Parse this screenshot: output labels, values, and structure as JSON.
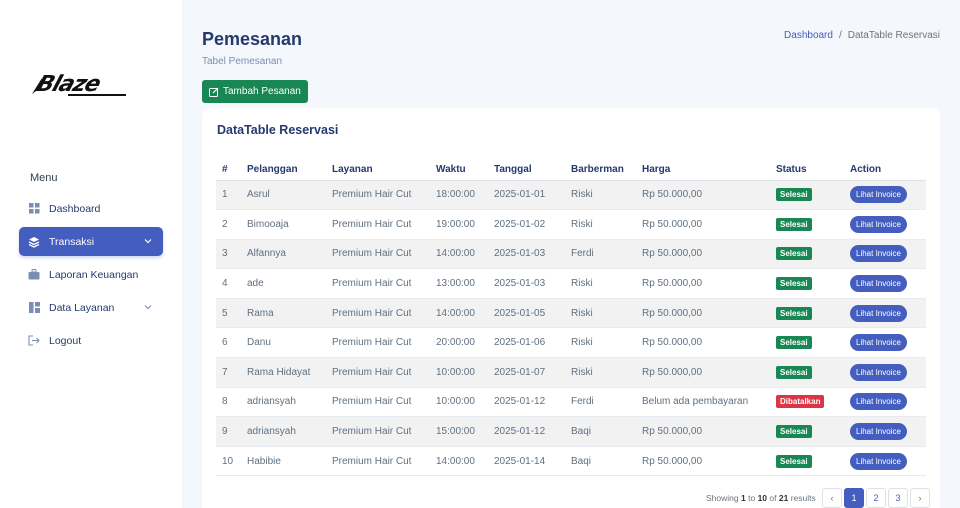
{
  "sidebar": {
    "logo_text": "Blaze",
    "menu_title": "Menu",
    "items": [
      {
        "label": "Dashboard",
        "icon": "grid-icon",
        "has_submenu": false,
        "active": false
      },
      {
        "label": "Transaksi",
        "icon": "stack-icon",
        "has_submenu": true,
        "active": true
      },
      {
        "label": "Laporan Keuangan",
        "icon": "briefcase-icon",
        "has_submenu": false,
        "active": false
      },
      {
        "label": "Data Layanan",
        "icon": "layout-icon",
        "has_submenu": true,
        "active": false
      },
      {
        "label": "Logout",
        "icon": "logout-icon",
        "has_submenu": false,
        "active": false
      }
    ]
  },
  "header": {
    "title": "Pemesanan",
    "subtitle": "Tabel Pemesanan",
    "breadcrumb": {
      "home": "Dashboard",
      "separator": "/",
      "current": "DataTable Reservasi"
    }
  },
  "actions": {
    "add_label": "Tambah Pesanan"
  },
  "card": {
    "title": "DataTable Reservasi"
  },
  "table": {
    "columns": [
      "#",
      "Pelanggan",
      "Layanan",
      "Waktu",
      "Tanggal",
      "Barberman",
      "Harga",
      "Status",
      "Action"
    ],
    "rows": [
      {
        "no": "1",
        "pelanggan": "Asrul",
        "layanan": "Premium Hair Cut",
        "waktu": "18:00:00",
        "tanggal": "2025-01-01",
        "barberman": "Riski",
        "harga": "Rp 50.000,00",
        "status": "Selesai",
        "action": "Lihat Invoice"
      },
      {
        "no": "2",
        "pelanggan": "Bimooaja",
        "layanan": "Premium Hair Cut",
        "waktu": "19:00:00",
        "tanggal": "2025-01-02",
        "barberman": "Riski",
        "harga": "Rp 50.000,00",
        "status": "Selesai",
        "action": "Lihat Invoice"
      },
      {
        "no": "3",
        "pelanggan": "Alfannya",
        "layanan": "Premium Hair Cut",
        "waktu": "14:00:00",
        "tanggal": "2025-01-03",
        "barberman": "Ferdi",
        "harga": "Rp 50.000,00",
        "status": "Selesai",
        "action": "Lihat Invoice"
      },
      {
        "no": "4",
        "pelanggan": "ade",
        "layanan": "Premium Hair Cut",
        "waktu": "13:00:00",
        "tanggal": "2025-01-03",
        "barberman": "Riski",
        "harga": "Rp 50.000,00",
        "status": "Selesai",
        "action": "Lihat Invoice"
      },
      {
        "no": "5",
        "pelanggan": "Rama",
        "layanan": "Premium Hair Cut",
        "waktu": "14:00:00",
        "tanggal": "2025-01-05",
        "barberman": "Riski",
        "harga": "Rp 50.000,00",
        "status": "Selesai",
        "action": "Lihat Invoice"
      },
      {
        "no": "6",
        "pelanggan": "Danu",
        "layanan": "Premium Hair Cut",
        "waktu": "20:00:00",
        "tanggal": "2025-01-06",
        "barberman": "Riski",
        "harga": "Rp 50.000,00",
        "status": "Selesai",
        "action": "Lihat Invoice"
      },
      {
        "no": "7",
        "pelanggan": "Rama Hidayat",
        "layanan": "Premium Hair Cut",
        "waktu": "10:00:00",
        "tanggal": "2025-01-07",
        "barberman": "Riski",
        "harga": "Rp 50.000,00",
        "status": "Selesai",
        "action": "Lihat Invoice"
      },
      {
        "no": "8",
        "pelanggan": "adriansyah",
        "layanan": "Premium Hair Cut",
        "waktu": "10:00:00",
        "tanggal": "2025-01-12",
        "barberman": "Ferdi",
        "harga": "Belum ada pembayaran",
        "status": "Dibatalkan",
        "action": "Lihat Invoice"
      },
      {
        "no": "9",
        "pelanggan": "adriansyah",
        "layanan": "Premium Hair Cut",
        "waktu": "15:00:00",
        "tanggal": "2025-01-12",
        "barberman": "Baqi",
        "harga": "Rp 50.000,00",
        "status": "Selesai",
        "action": "Lihat Invoice"
      },
      {
        "no": "10",
        "pelanggan": "Habibie",
        "layanan": "Premium Hair Cut",
        "waktu": "14:00:00",
        "tanggal": "2025-01-14",
        "barberman": "Baqi",
        "harga": "Rp 50.000,00",
        "status": "Selesai",
        "action": "Lihat Invoice"
      }
    ]
  },
  "pagination": {
    "info_prefix": "Showing",
    "from": "1",
    "to_word": "to",
    "to": "10",
    "of_word": "of",
    "total": "21",
    "suffix": "results",
    "prev": "‹",
    "pages": [
      "1",
      "2",
      "3"
    ],
    "current": "1",
    "next": "›"
  },
  "colors": {
    "primary": "#435ebe",
    "success": "#198754",
    "danger": "#dc3545"
  }
}
